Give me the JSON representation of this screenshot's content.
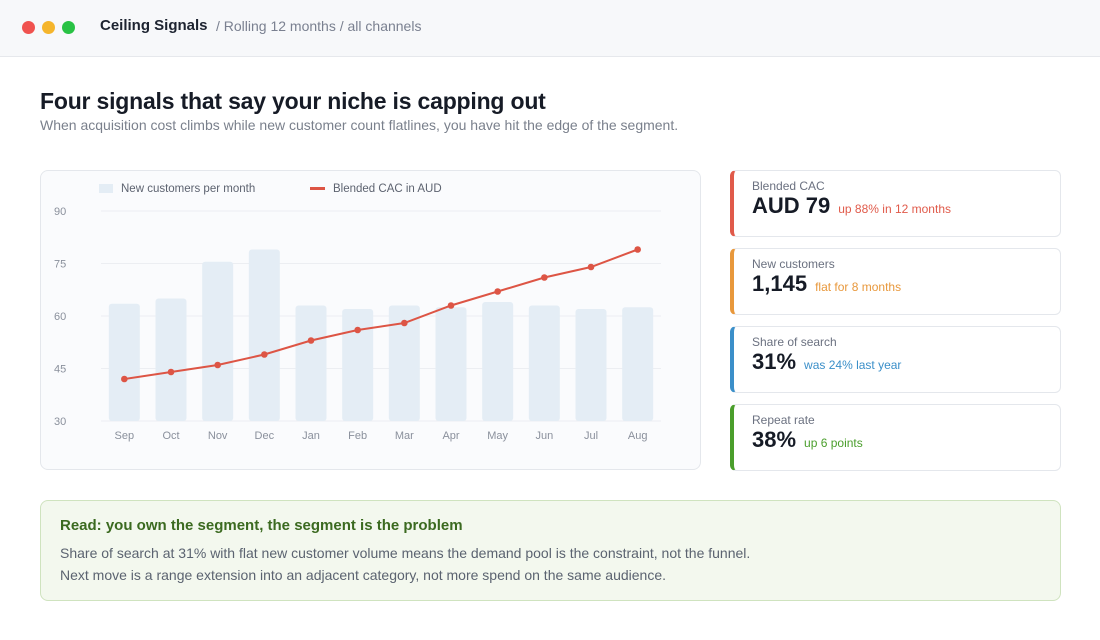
{
  "window": {
    "app_title": "Ceiling Signals",
    "breadcrumb": "/ Rolling 12 months / all channels"
  },
  "page": {
    "heading": "Four signals that say your niche is capping out",
    "subheading": "When acquisition cost climbs while new customer count flatlines, you have hit the edge of the segment."
  },
  "chart_data": {
    "type": "bar",
    "categories": [
      "Sep",
      "Oct",
      "Nov",
      "Dec",
      "Jan",
      "Feb",
      "Mar",
      "Apr",
      "May",
      "Jun",
      "Jul",
      "Aug"
    ],
    "series": [
      {
        "name": "New customers per month",
        "type": "bar",
        "values": [
          63.5,
          65,
          75.5,
          79,
          63,
          62,
          63,
          62.5,
          64,
          63,
          62,
          62.5
        ]
      },
      {
        "name": "Blended CAC in AUD",
        "type": "line",
        "values": [
          42,
          44,
          46,
          49,
          53,
          56,
          58,
          63,
          67,
          71,
          74,
          79
        ]
      }
    ],
    "ylim": [
      30,
      90
    ],
    "yticks": [
      30,
      45,
      60,
      75,
      90
    ],
    "grid": true,
    "legend": "top-left",
    "colors": {
      "bar": "#e4edf5",
      "line": "#dd5545"
    }
  },
  "stats": [
    {
      "label": "Blended CAC",
      "value": "AUD 79",
      "note": "up 88% in 12 months",
      "color": "#e05a4a"
    },
    {
      "label": "New customers",
      "value": "1,145",
      "note": "flat for 8 months",
      "color": "#e8983c"
    },
    {
      "label": "Share of search",
      "value": "31%",
      "note": "was 24% last year",
      "color": "#3b8fc9"
    },
    {
      "label": "Repeat rate",
      "value": "38%",
      "note": "up 6 points",
      "color": "#4a9e2b"
    }
  ],
  "insight": {
    "title": "Read: you own the segment, the segment is the problem",
    "line1": "Share of search at 31% with flat new customer volume means the demand pool is the constraint, not the funnel.",
    "line2": "Next move is a range extension into an adjacent category, not more spend on the same audience."
  }
}
